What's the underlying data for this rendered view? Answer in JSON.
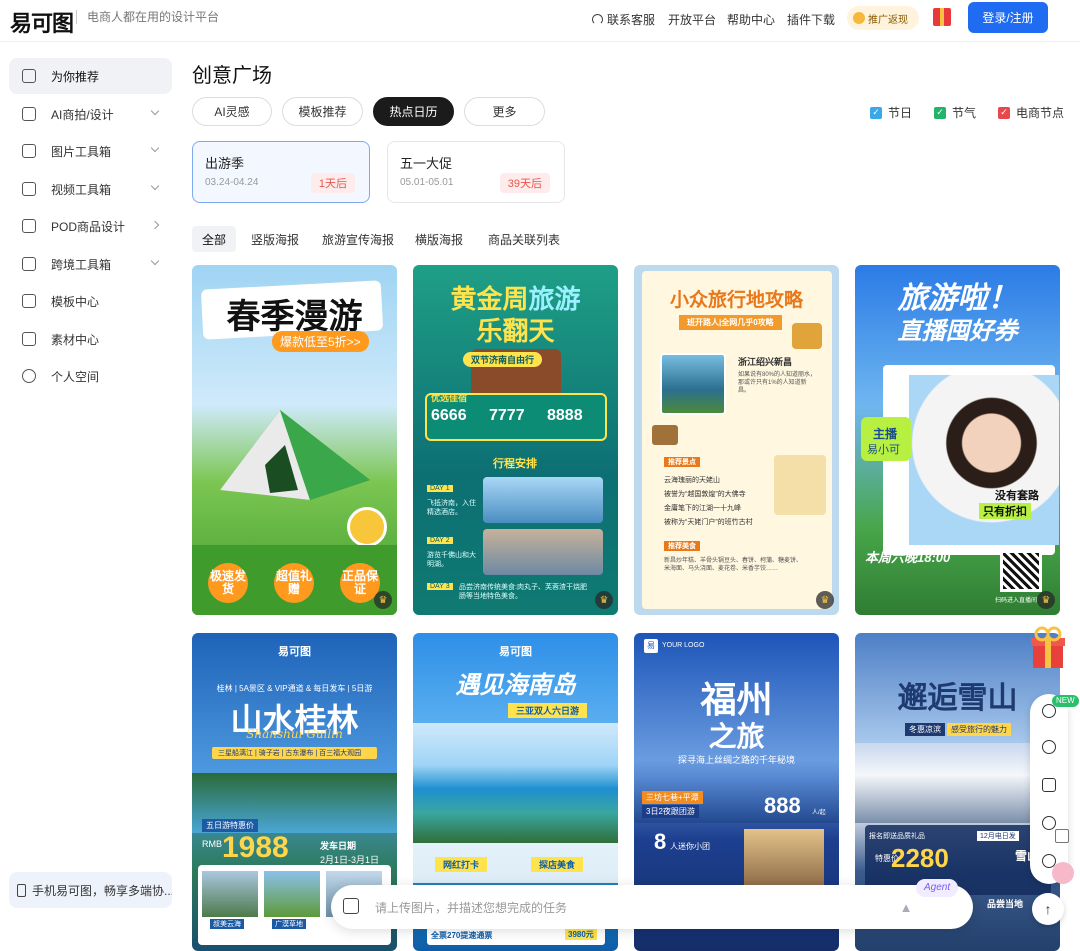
{
  "header": {
    "logo": "易可图",
    "slogan": "电商人都在用的设计平台",
    "nav": [
      "联系客服",
      "开放平台",
      "帮助中心",
      "插件下载"
    ],
    "promo": "推广返现",
    "login": "登录/注册"
  },
  "sidebar": {
    "items": [
      {
        "label": "为你推荐",
        "icon": "home-icon"
      },
      {
        "label": "AI商拍/设计",
        "icon": "ai-icon"
      },
      {
        "label": "图片工具箱",
        "icon": "image-tools-icon"
      },
      {
        "label": "视频工具箱",
        "icon": "video-tools-icon"
      },
      {
        "label": "POD商品设计",
        "icon": "pod-icon"
      },
      {
        "label": "跨境工具箱",
        "icon": "crossborder-icon"
      },
      {
        "label": "模板中心",
        "icon": "template-icon"
      },
      {
        "label": "素材中心",
        "icon": "material-icon"
      },
      {
        "label": "个人空间",
        "icon": "user-icon"
      }
    ],
    "bottom": "手机易可图，畅享多端协..."
  },
  "main": {
    "title": "创意广场",
    "tabs": [
      "AI灵感",
      "模板推荐",
      "热点日历",
      "更多"
    ],
    "filters": [
      {
        "label": "节日",
        "color": "#3aa7e8"
      },
      {
        "label": "节气",
        "color": "#23b36b"
      },
      {
        "label": "电商节点",
        "color": "#e8484b"
      }
    ],
    "events": [
      {
        "name": "出游季",
        "date": "03.24-04.24",
        "badge": "1天后"
      },
      {
        "name": "五一大促",
        "date": "05.01-05.01",
        "badge": "39天后"
      }
    ],
    "subtabs": [
      "全部",
      "竖版海报",
      "旅游宣传海报",
      "横版海报",
      "商品关联列表"
    ]
  },
  "cards": {
    "c1": {
      "title": "春季漫游",
      "tag": "爆款低至5折>>",
      "badges": [
        "极速发货",
        "超值礼赠",
        "正品保证"
      ]
    },
    "c2": {
      "title1": "黄金周",
      "title2": "旅游",
      "title3": "乐翻天",
      "sub": "双节济南自由行",
      "label": "优选佳宿",
      "p1": "6666",
      "p2": "7777",
      "p3": "8888",
      "sched": "行程安排",
      "day1": "DAY 1",
      "d1text": "飞抵济南，入住精选酒店。",
      "day2": "DAY 2",
      "d2text": "游览千佛山和大明湖。",
      "day3": "DAY 3",
      "d3text": "品尝济南传统美食:肉丸子、芙蓉渣干烧肥肠等当地特色美食。"
    },
    "c3": {
      "title": "小众旅行地攻略",
      "sub": "班开路人|全网几乎0攻略",
      "loc": "浙江绍兴新昌",
      "desc": "如果说有80%的人知道丽水，那或许只有1%的人知道新昌。",
      "sec1": "推荐景点",
      "spots": [
        "云海瑰丽的天姥山",
        "被誉为“越国敦煌”的大佛寺",
        "金庸笔下的江湖一十九峰",
        "被称为“天姥门户”的班竹古村"
      ],
      "sec2": "推荐美食",
      "food": "新昌炒年糕、羊骨头锅豆头、春饼、柯蒲、糖麦饼、米海面、马头浇面、麦花卷、米香芋饺……"
    },
    "c4": {
      "title1": "旅游啦！",
      "title2": "直播囤好券",
      "host": "主播",
      "name": "易小可",
      "tag1": "没有套路",
      "tag2": "只有折扣",
      "time": "本周六晚18:00",
      "qr": "扫码进入直播间"
    },
    "c5": {
      "logo": "易可图",
      "sub": "桂林 | 5A景区 & VIP通道 & 每日发车 | 5日游",
      "title": "山水桂林",
      "pinyin": "Shanshui Guilin",
      "tags": "三星船漓江 | 骑子岩 | 古东瀑布 | 百三福大观园",
      "price_label": "五日游特惠价",
      "currency": "RMB",
      "price": "1988",
      "dep": "发车日期",
      "dep_date": "2月1日-3月1日",
      "spot1": "叔美云海",
      "spot2": "广漠草地"
    },
    "c6": {
      "logo": "易可图",
      "title": "遇见海南岛",
      "sub": "三亚双人六日游",
      "tag1": "网红打卡",
      "tag2": "探店美食",
      "ticket": "全票270提速通票",
      "price": "3980元"
    },
    "c7": {
      "logo": "YOUR LOGO",
      "title1": "福州",
      "title2": "之旅",
      "sub": "探寻海上丝绸之路的千年秘境",
      "tour": "三坊七巷+平潭",
      "days": "3日2夜跟团游",
      "price": "888",
      "unit": "人/起",
      "num": "8",
      "small": "人迷你小团"
    },
    "c8": {
      "title": "邂逅雪山",
      "sub1": "冬惠凉滨",
      "sub2": "感受旅行的魅力",
      "notice": "报名即送品质礼品",
      "num_days": "12月电日发",
      "price_label": "特惠价",
      "price": "2280",
      "loc": "雪山",
      "tag": "品尝当地"
    }
  },
  "float": {
    "new": "NEW"
  },
  "agent": {
    "placeholder": "请上传图片，并描述您想完成的任务",
    "tag": "Agent"
  }
}
